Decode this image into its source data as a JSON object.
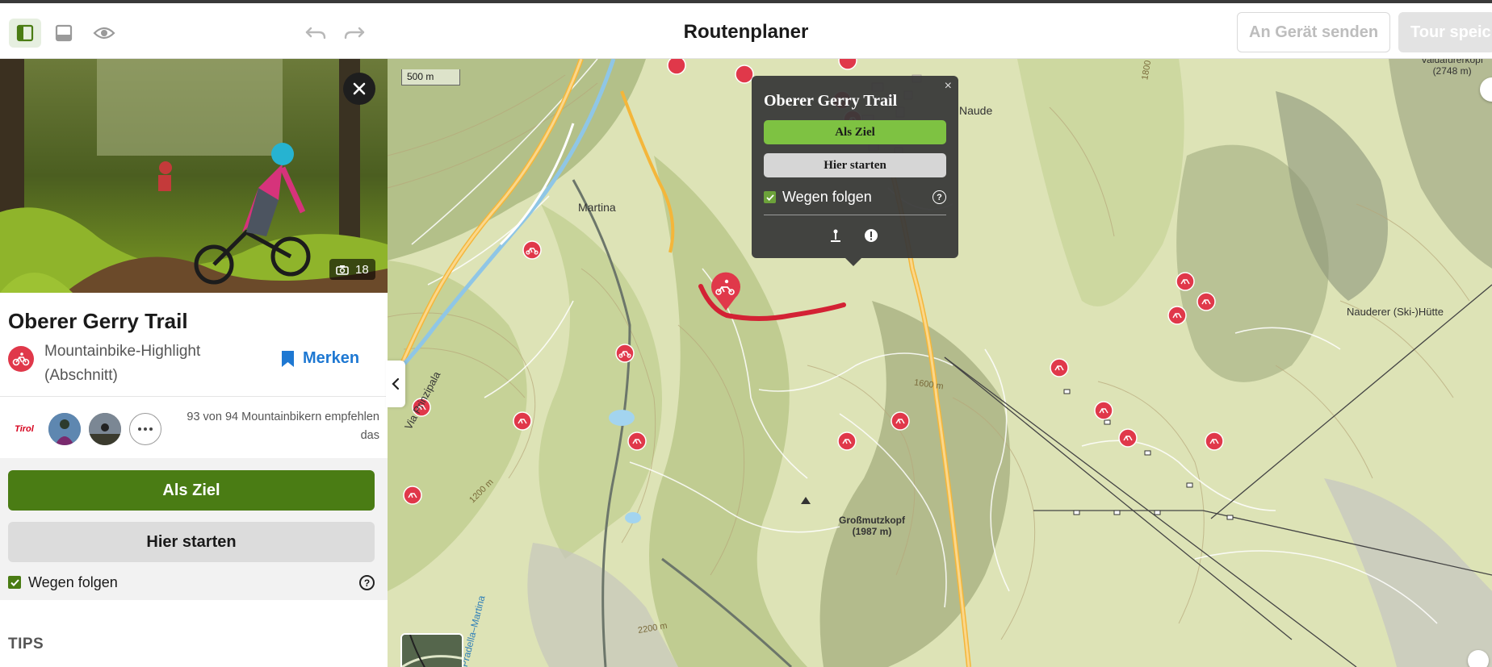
{
  "header": {
    "title": "Routenplaner",
    "send_button": "An Gerät senden",
    "save_button": "Tour speich",
    "icons": [
      "sidebar-panel-icon",
      "bottom-panel-icon",
      "eye-icon",
      "undo-icon",
      "redo-icon"
    ]
  },
  "sidebar": {
    "photo_count": "18",
    "title": "Oberer Gerry Trail",
    "category_line1": "Mountainbike-Highlight",
    "category_line2": "(Abschnitt)",
    "bookmark_label": "Merken",
    "recommend_text": "93 von 94 Mountainbikern empfehlen das",
    "logo_text": "Tirol",
    "primary_button": "Als Ziel",
    "secondary_button": "Hier starten",
    "follow_label": "Wegen folgen",
    "help_glyph": "?",
    "section_heading": "TIPS"
  },
  "map": {
    "scale_label": "500 m",
    "labels": {
      "martina": "Martina",
      "via_prinzipala": "Via Prinzipala",
      "pradella_martina": "Pradella–Martina",
      "grossmutzkopf": "Großmutzkopf",
      "grossmutzkopf_elev": "(1987 m)",
      "nauderer_huette": "Nauderer (Ski-)Hütte",
      "peak_elev": "(2748 m)",
      "peak_name": "Valdafurerkopf",
      "contour_1600": "1600 m",
      "contour_1200": "1200 m",
      "contour_2200": "2200 m",
      "contour_1800": "1800",
      "nauders": "Naude"
    }
  },
  "popup": {
    "title": "Oberer Gerry Trail",
    "close_glyph": "×",
    "primary_button": "Als Ziel",
    "secondary_button": "Hier starten",
    "follow_label": "Wegen folgen",
    "help_glyph": "?"
  },
  "colors": {
    "accent_green": "#4a7c14",
    "popup_green": "#7ec242",
    "marker_red": "#e0384a",
    "link_blue": "#1e78d2"
  }
}
